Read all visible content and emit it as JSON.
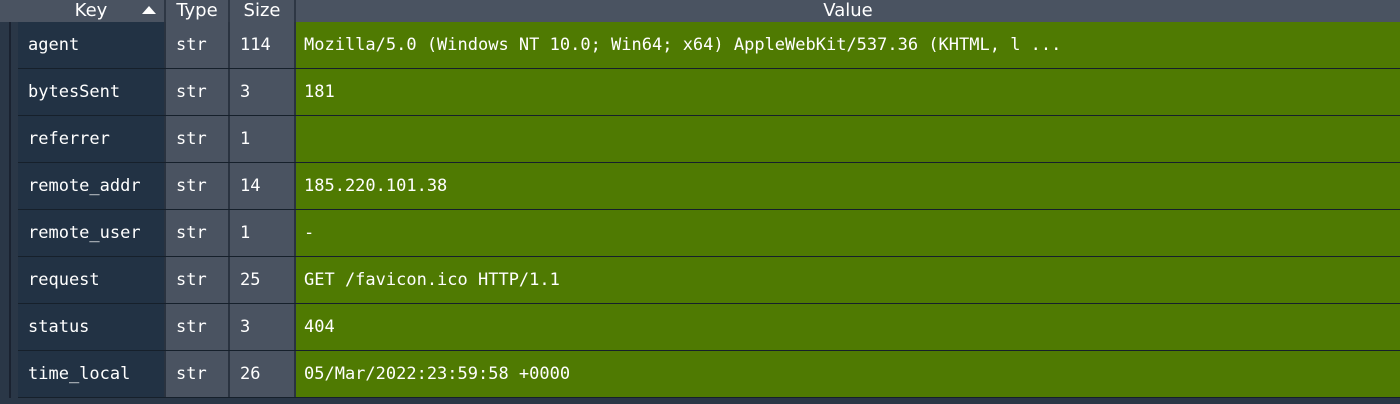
{
  "header": {
    "key": "Key",
    "type": "Type",
    "size": "Size",
    "value": "Value"
  },
  "rows": [
    {
      "key": "agent",
      "type": "str",
      "size": "114",
      "value": "Mozilla/5.0 (Windows NT 10.0; Win64; x64) AppleWebKit/537.36 (KHTML, l ..."
    },
    {
      "key": "bytesSent",
      "type": "str",
      "size": "3",
      "value": "181"
    },
    {
      "key": "referrer",
      "type": "str",
      "size": "1",
      "value": ""
    },
    {
      "key": "remote_addr",
      "type": "str",
      "size": "14",
      "value": "185.220.101.38"
    },
    {
      "key": "remote_user",
      "type": "str",
      "size": "1",
      "value": "-"
    },
    {
      "key": "request",
      "type": "str",
      "size": "25",
      "value": "GET /favicon.ico HTTP/1.1"
    },
    {
      "key": "status",
      "type": "str",
      "size": "3",
      "value": "404"
    },
    {
      "key": "time_local",
      "type": "str",
      "size": "26",
      "value": "05/Mar/2022:23:59:58 +0000"
    }
  ],
  "colors": {
    "value_cell_bg": "#4f7a02",
    "key_cell_bg": "#223244",
    "type_size_cell_bg": "#4a5361"
  }
}
